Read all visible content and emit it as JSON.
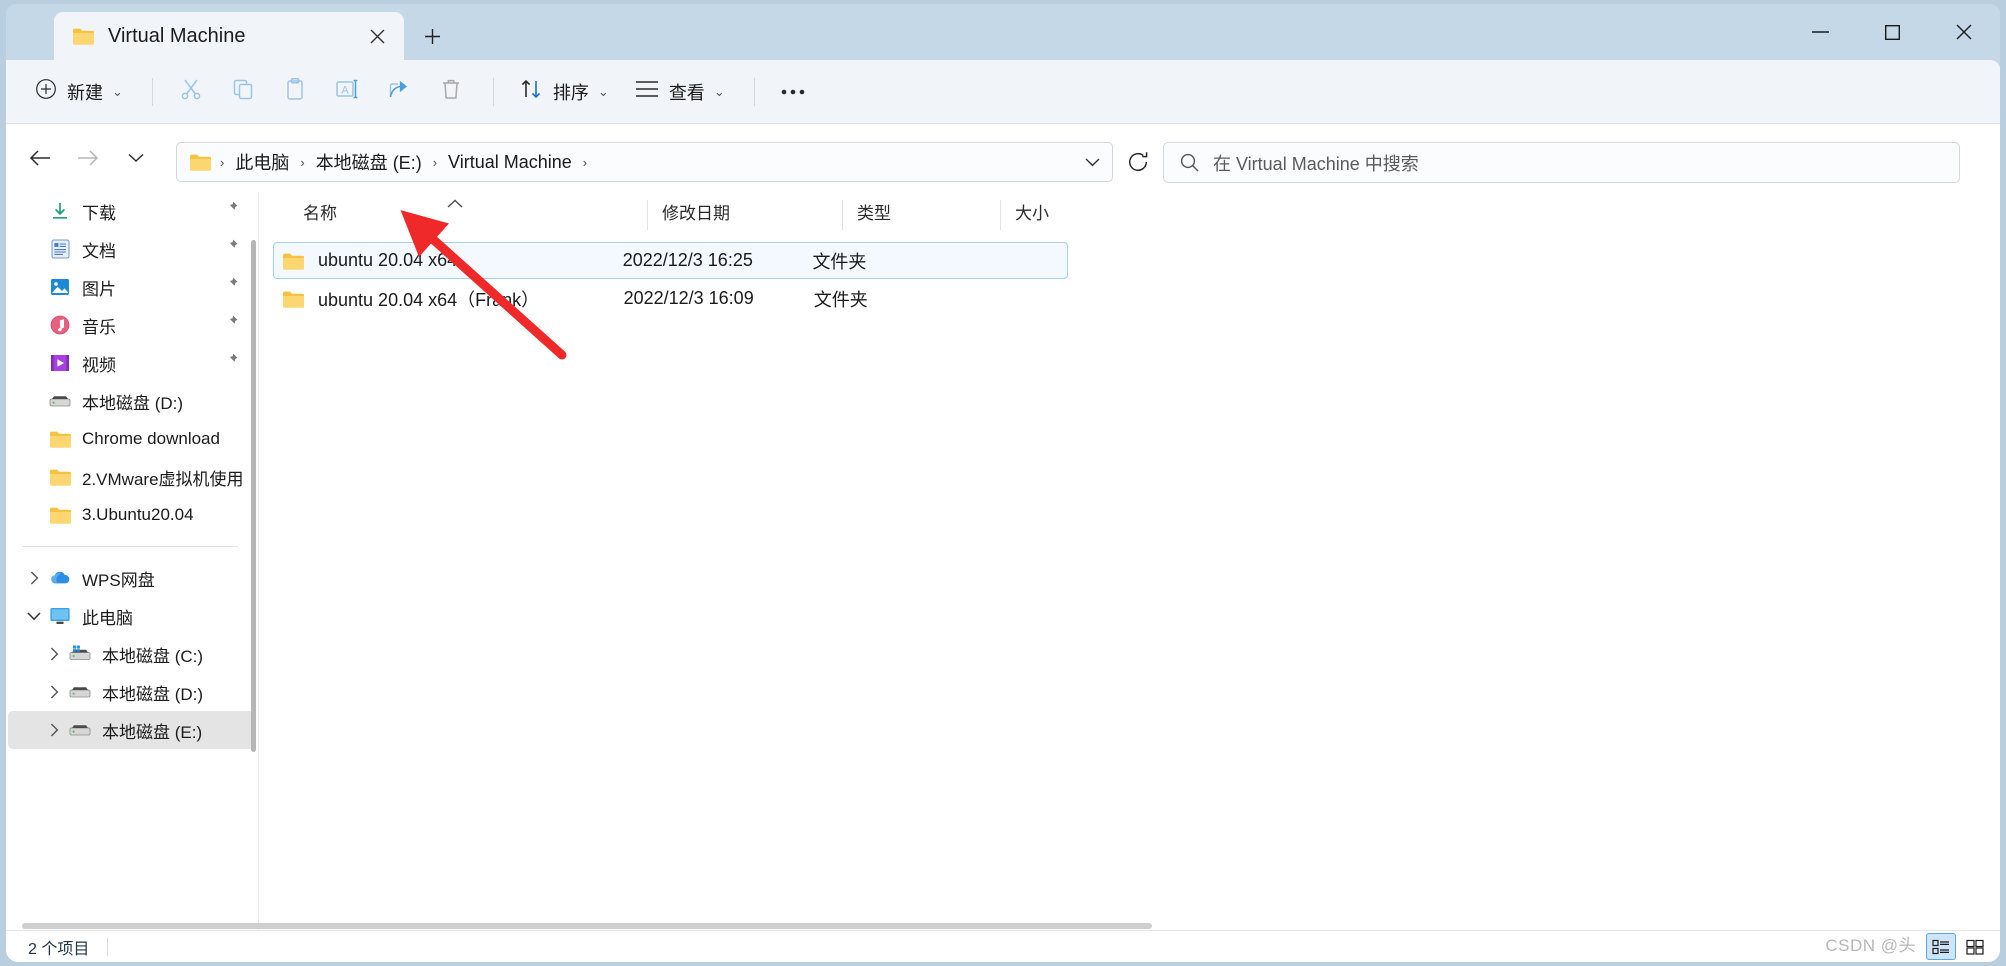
{
  "window": {
    "minimize_label": "—",
    "maximize_label": "□",
    "close_label": "✕"
  },
  "tab": {
    "title": "Virtual Machine",
    "close_label": "✕",
    "new_tab_label": "+"
  },
  "toolbar": {
    "new_label": "新建",
    "chevron": "⌄",
    "cut_name": "剪切",
    "copy_name": "复制",
    "paste_name": "粘贴",
    "rename_name": "重命名",
    "share_name": "共享",
    "delete_name": "删除",
    "sort_label": "排序",
    "view_label": "查看",
    "more_label": "•••"
  },
  "navigation": {
    "back": "←",
    "forward": "→",
    "recent": "⌄",
    "up": "↑",
    "refresh_label": "⟳",
    "address_dropdown": "⌄",
    "breadcrumbs": [
      "此电脑",
      "本地磁盘 (E:)",
      "Virtual Machine"
    ],
    "separator": "›"
  },
  "search": {
    "placeholder": "在 Virtual Machine 中搜索"
  },
  "sidebar": {
    "quick_access": [
      {
        "label": "下载",
        "icon": "download-icon",
        "pinned": true
      },
      {
        "label": "文档",
        "icon": "documents-icon",
        "pinned": true
      },
      {
        "label": "图片",
        "icon": "pictures-icon",
        "pinned": true
      },
      {
        "label": "音乐",
        "icon": "music-icon",
        "pinned": true
      },
      {
        "label": "视频",
        "icon": "videos-icon",
        "pinned": true
      },
      {
        "label": "本地磁盘 (D:)",
        "icon": "drive-icon",
        "pinned": false
      },
      {
        "label": "Chrome download",
        "icon": "folder-icon",
        "pinned": false
      },
      {
        "label": "2.VMware虚拟机使用",
        "icon": "folder-icon",
        "pinned": false
      },
      {
        "label": "3.Ubuntu20.04",
        "icon": "folder-icon",
        "pinned": false
      }
    ],
    "cloud": [
      {
        "label": "WPS网盘",
        "icon": "cloud-icon",
        "expandable": true
      }
    ],
    "this_pc": {
      "label": "此电脑",
      "icon": "monitor-icon",
      "expanded": true,
      "children": [
        {
          "label": "本地磁盘 (C:)",
          "icon": "system-drive-icon",
          "selected": false
        },
        {
          "label": "本地磁盘 (D:)",
          "icon": "drive-icon",
          "selected": false
        },
        {
          "label": "本地磁盘 (E:)",
          "icon": "drive-icon",
          "selected": true
        }
      ]
    }
  },
  "filelist": {
    "columns": [
      "名称",
      "修改日期",
      "类型",
      "大小"
    ],
    "sort_indicator": "⌃",
    "rows": [
      {
        "name": "ubuntu 20.04 x64",
        "date": "2022/12/3 16:25",
        "type": "文件夹",
        "size": "",
        "selected": true
      },
      {
        "name": "ubuntu 20.04 x64（Frank）",
        "date": "2022/12/3 16:09",
        "type": "文件夹",
        "size": "",
        "selected": false
      }
    ]
  },
  "statusbar": {
    "item_count": "2 个项目",
    "details_view_name": "详细信息视图",
    "large_icons_view_name": "大图标视图"
  },
  "watermark": {
    "text": "CSDN @头"
  },
  "colors": {
    "titlebar": "#c4d8e7",
    "command_bar": "#f1f5f9",
    "selection_border": "#a3d0f0",
    "selection_fill": "#f3f9fe",
    "annotation_arrow": "#ef2929",
    "folder_yellow": "#fbc94b"
  }
}
